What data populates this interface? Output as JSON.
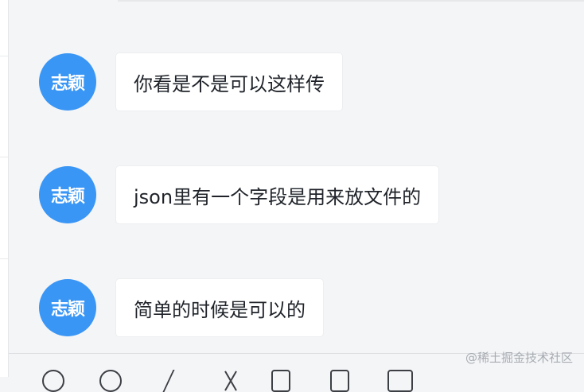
{
  "messages": [
    {
      "sender": "志颖",
      "text": "你看是不是可以这样传"
    },
    {
      "sender": "志颖",
      "text": "json里有一个字段是用来放文件的"
    },
    {
      "sender": "志颖",
      "text": "简单的时候是可以的"
    }
  ],
  "toolbar": {
    "icons": [
      "emoji-icon",
      "history-icon",
      "scissors-icon",
      "cut-icon",
      "file-icon",
      "folder-icon",
      "more-icon"
    ]
  },
  "watermark": "@稀土掘金技术社区",
  "colors": {
    "avatar_bg": "#3a96f5",
    "page_bg": "#f4f5f7",
    "bubble_bg": "#ffffff",
    "text": "#1f2329"
  }
}
